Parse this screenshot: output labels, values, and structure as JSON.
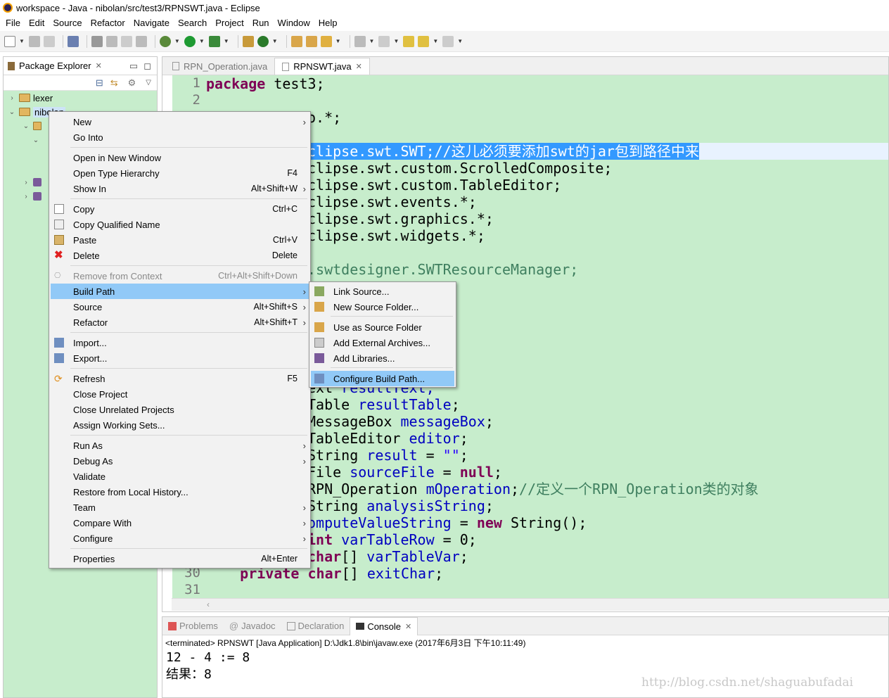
{
  "window": {
    "title": "workspace - Java - nibolan/src/test3/RPNSWT.java - Eclipse"
  },
  "menubar": [
    "File",
    "Edit",
    "Source",
    "Refactor",
    "Navigate",
    "Search",
    "Project",
    "Run",
    "Window",
    "Help"
  ],
  "package_explorer": {
    "title": "Package Explorer",
    "items": [
      {
        "label": "lexer"
      },
      {
        "label": "nibolan"
      }
    ]
  },
  "editor": {
    "tabs": [
      {
        "label": "RPN_Operation.java",
        "active": false
      },
      {
        "label": "RPNSWT.java",
        "active": true
      }
    ],
    "line_numbers": [
      "1",
      "2",
      "30",
      "31"
    ],
    "lines": {
      "l1_kw": "package",
      "l1_rest": " test3;",
      "l3": "o.*;",
      "l5_sel": "clipse.swt.SWT;//这儿必须要添加swt的jar包到路径中来",
      "l6": "clipse.swt.custom.ScrolledComposite;",
      "l7": "clipse.swt.custom.TableEditor;",
      "l8": "clipse.swt.events.*;",
      "l9": "clipse.swt.graphics.*;",
      "l10": "clipse.swt.widgets.*;",
      "l12": ".swtdesigner.SWTResourceManager;",
      "l18a": "ext ",
      "l18b": "resultText;",
      "l19a": "Table ",
      "l19b": "resultTable",
      "l19c": ";",
      "l20a": "MessageBox ",
      "l20b": "messageBox",
      "l20c": ";",
      "l21a": "TableEditor ",
      "l21b": "editor",
      "l21c": ";",
      "l22a": "String ",
      "l22b": "result",
      "l22c": " = ",
      "l22d": "\"\"",
      "l22e": ";",
      "l23a": "File ",
      "l23b": "sourceFile",
      "l23c": " = ",
      "l23d": "null",
      "l23e": ";",
      "l24a": "RPN_Operation ",
      "l24b": "mOperation",
      "l24c": ";",
      "l24d": "//定义一个RPN_Operation类的对象",
      "l25a": "String ",
      "l25b": "analysisString",
      "l25c": ";",
      "l26a": "omputeValueString",
      "l26b": " = ",
      "l26c": "new",
      "l26d": " String();",
      "l27a": "int",
      "l27b": " ",
      "l27c": "varTableRow",
      "l27d": " = 0;",
      "l28a": "char",
      "l28b": "[] ",
      "l28c": "varTableVar",
      "l28d": ";",
      "l30a": "    ",
      "l30b": "private",
      "l30c": " ",
      "l30d": "char",
      "l30e": "[] ",
      "l30f": "exitChar",
      "l30g": ";"
    }
  },
  "context_menu": {
    "items": [
      {
        "label": "New",
        "accel": "",
        "arrow": true
      },
      {
        "label": "Go Into",
        "accel": ""
      },
      {
        "label": "Open in New Window",
        "accel": ""
      },
      {
        "label": "Open Type Hierarchy",
        "accel": "F4"
      },
      {
        "label": "Show In",
        "accel": "Alt+Shift+W",
        "arrow": true
      },
      {
        "label": "Copy",
        "accel": "Ctrl+C"
      },
      {
        "label": "Copy Qualified Name",
        "accel": ""
      },
      {
        "label": "Paste",
        "accel": "Ctrl+V"
      },
      {
        "label": "Delete",
        "accel": "Delete"
      },
      {
        "label": "Remove from Context",
        "accel": "Ctrl+Alt+Shift+Down",
        "disabled": true
      },
      {
        "label": "Build Path",
        "accel": "",
        "arrow": true,
        "selected": true
      },
      {
        "label": "Source",
        "accel": "Alt+Shift+S",
        "arrow": true
      },
      {
        "label": "Refactor",
        "accel": "Alt+Shift+T",
        "arrow": true
      },
      {
        "label": "Import...",
        "accel": ""
      },
      {
        "label": "Export...",
        "accel": ""
      },
      {
        "label": "Refresh",
        "accel": "F5"
      },
      {
        "label": "Close Project",
        "accel": ""
      },
      {
        "label": "Close Unrelated Projects",
        "accel": ""
      },
      {
        "label": "Assign Working Sets...",
        "accel": ""
      },
      {
        "label": "Run As",
        "accel": "",
        "arrow": true
      },
      {
        "label": "Debug As",
        "accel": "",
        "arrow": true
      },
      {
        "label": "Validate",
        "accel": ""
      },
      {
        "label": "Restore from Local History...",
        "accel": ""
      },
      {
        "label": "Team",
        "accel": "",
        "arrow": true
      },
      {
        "label": "Compare With",
        "accel": "",
        "arrow": true
      },
      {
        "label": "Configure",
        "accel": "",
        "arrow": true
      },
      {
        "label": "Properties",
        "accel": "Alt+Enter"
      }
    ]
  },
  "build_path_submenu": {
    "items": [
      {
        "label": "Link Source..."
      },
      {
        "label": "New Source Folder..."
      },
      {
        "label": "Use as Source Folder"
      },
      {
        "label": "Add External Archives..."
      },
      {
        "label": "Add Libraries..."
      },
      {
        "label": "Configure Build Path...",
        "selected": true
      }
    ]
  },
  "console": {
    "tabs": [
      {
        "label": "Problems",
        "active": false
      },
      {
        "label": "Javadoc",
        "active": false
      },
      {
        "label": "Declaration",
        "active": false
      },
      {
        "label": "Console",
        "active": true
      }
    ],
    "status": "<terminated> RPNSWT [Java Application] D:\\Jdk1.8\\bin\\javaw.exe (2017年6月3日 下午10:11:49)",
    "output": [
      "12 - 4 := 8",
      "结果：8"
    ]
  },
  "watermark": "http://blog.csdn.net/shaguabufadai",
  "colors": {
    "editor_bg": "#c7edcc",
    "selection": "#3399ff",
    "menu_highlight": "#91c9f7",
    "keyword": "#7f0055",
    "field": "#0000c0",
    "comment": "#3f7f5f"
  }
}
